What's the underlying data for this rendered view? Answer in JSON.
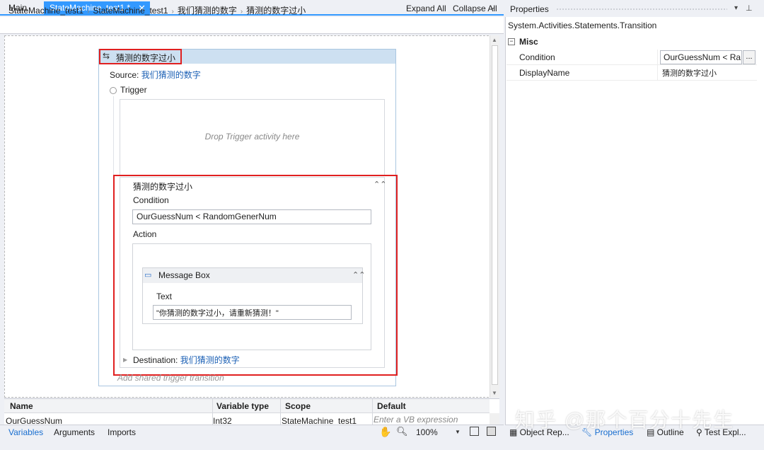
{
  "tabs": {
    "main": "Main",
    "active": "StateMachine_test1 *",
    "close": "✕",
    "dropdown": "⌄"
  },
  "breadcrumb": {
    "items": [
      "StateMachine_test1",
      "StateMachine_test1",
      "我们猜测的数字",
      "猜测的数字过小"
    ],
    "separator": "›",
    "expand_all": "Expand All",
    "collapse_all": "Collapse All"
  },
  "transition": {
    "title": "猜测的数字过小",
    "source_prefix": "Source: ",
    "source_link": "我们猜测的数字",
    "trigger_label": "Trigger",
    "drop_placeholder": "Drop Trigger activity here",
    "inner_title": "猜测的数字过小",
    "condition_label": "Condition",
    "condition_value": "OurGuessNum < RandomGenerNum",
    "action_label": "Action",
    "message_box_title": "Message Box",
    "text_label": "Text",
    "text_value": "\"你猜测的数字过小，请重新猜测！\"",
    "destination_prefix": "Destination: ",
    "destination_link": "我们猜测的数字",
    "add_shared": "Add shared trigger transition"
  },
  "variables": {
    "headers": [
      "Name",
      "Variable type",
      "Scope",
      "Default"
    ],
    "row": {
      "name": "OurGuessNum",
      "type": "Int32",
      "scope": "StateMachine_test1",
      "default_placeholder": "Enter a VB expression"
    }
  },
  "bottom_tabs": {
    "variables": "Variables",
    "arguments": "Arguments",
    "imports": "Imports",
    "zoom": "100%"
  },
  "properties": {
    "title": "Properties",
    "type": "System.Activities.Statements.Transition",
    "category": "Misc",
    "condition_label": "Condition",
    "condition_value": "OurGuessNum < Ra",
    "display_name_label": "DisplayName",
    "display_name_value": "猜测的数字过小",
    "ellipsis": "..."
  },
  "right_tabs": {
    "object_repo": "Object Rep...",
    "properties": "Properties",
    "outline": "Outline",
    "test": "Test Expl..."
  },
  "watermark": "知乎 @那个百分十先生",
  "colors": {
    "accent": "#3399ff",
    "highlight": "#e02020",
    "link": "#1a5fb4"
  }
}
